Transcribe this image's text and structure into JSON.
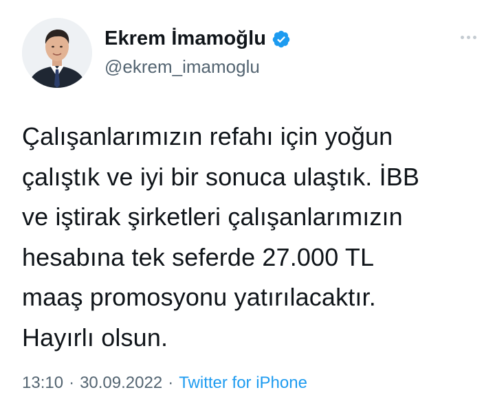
{
  "user": {
    "display_name": "Ekrem İmamoğlu",
    "handle": "@ekrem_imamoglu",
    "verified_icon": "verified-badge-icon",
    "avatar_icon": "avatar-photo"
  },
  "tweet": {
    "text": "Çalışanlarımızın refahı için yoğun\nçalıştık ve iyi bir sonuca ulaştık. İBB\nve iştirak şirketleri çalışanlarımızın\nhesabına tek seferde 27.000 TL\nmaaş promosyonu yatırılacaktır.\nHayırlı olsun.",
    "time": "13:10",
    "separator_1": "·",
    "date": "30.09.2022",
    "separator_2": "·",
    "source": "Twitter for iPhone"
  },
  "more_icon": "more-dots-icon",
  "colors": {
    "text": "#0f1419",
    "secondary": "#536471",
    "accent": "#1d9bf0",
    "verified": "#1d9bf0"
  }
}
